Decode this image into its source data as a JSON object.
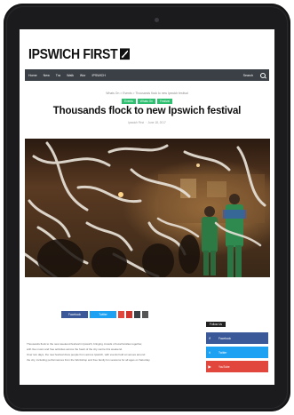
{
  "site": {
    "logo": "IPSWICH FIRST"
  },
  "nav": {
    "items": [
      "Home",
      "New",
      "Tra",
      "Walk",
      "Wor",
      "IPSWICH"
    ],
    "search_label": "Search"
  },
  "article": {
    "breadcrumb": "Whats On > Events > Thousands flock to new Ipswich festival",
    "tags": [
      "Events",
      "Whats On",
      "Festival"
    ],
    "title": "Thousands flock to new Ipswich festival",
    "author": "Ipswich First",
    "date": "June 18, 2017",
    "excerpt_lines": [
      "Thousands flock to the new weekend festival in Ipswich, bringing crowds of local families together,",
      "with live music and free activities across the heart of the city centre this weekend.",
      "Over two days, the new festival drew people from across Ipswich, with events held at venues around",
      "the city, including performances from the Workshop and free family fun sessions for all ages on Saturday."
    ]
  },
  "share": {
    "facebook_label": "Facebook",
    "twitter_label": "Twitter",
    "colors": [
      "#3b5998",
      "#1da1f2",
      "#e2473d",
      "#d0342c",
      "#3b4046",
      "#555555"
    ]
  },
  "sidebar": {
    "follow_label": "Follow Us",
    "socials": [
      {
        "icon": "facebook-icon",
        "glyph": "f",
        "label": "Facebook",
        "color": "#3b5998"
      },
      {
        "icon": "twitter-icon",
        "glyph": "t",
        "label": "Twitter",
        "color": "#1da1f2"
      },
      {
        "icon": "youtube-icon",
        "glyph": "▶",
        "label": "YouTube",
        "color": "#e2473d"
      }
    ]
  },
  "colors": {
    "nav_bg": "#3b4046",
    "tag_green": "#2fbf71",
    "device_frame": "#1b1b1d"
  }
}
